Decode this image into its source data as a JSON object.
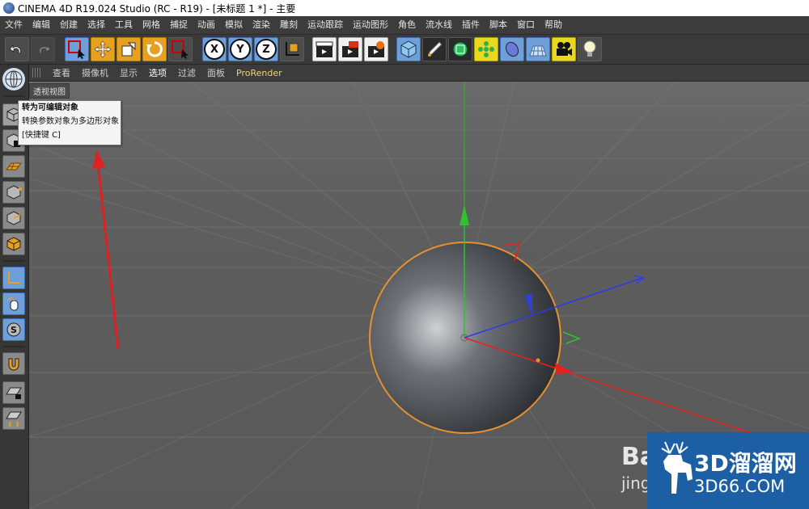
{
  "app": {
    "title": "CINEMA 4D R19.024 Studio (RC - R19) - [未标题 1 *] - 主要"
  },
  "menubar": {
    "items": [
      "文件",
      "编辑",
      "创建",
      "选择",
      "工具",
      "网格",
      "捕捉",
      "动画",
      "模拟",
      "渲染",
      "雕刻",
      "运动跟踪",
      "运动图形",
      "角色",
      "流水线",
      "插件",
      "脚本",
      "窗口",
      "帮助"
    ]
  },
  "toolbar": {
    "axis_x": "X",
    "axis_y": "Y",
    "axis_z": "Z"
  },
  "viewport_menu": {
    "items": [
      "查看",
      "摄像机",
      "显示",
      "选项",
      "过滤",
      "面板",
      "ProRender"
    ]
  },
  "viewport": {
    "label": "透视视图"
  },
  "tooltip": {
    "title": "转为可编辑对象",
    "description": "转换参数对象为多边形对象",
    "shortcut": "[快捷键 C]"
  },
  "watermark": {
    "baidu": "Bai",
    "jingyan": "jing",
    "site_name": "3D溜溜网",
    "site_url": "3D66.COM"
  },
  "colors": {
    "viewport_bg": "#5e5e5e",
    "accent_orange": "#e8a020",
    "axis_x": "#e02020",
    "axis_y": "#20c020",
    "axis_z": "#2040e0"
  }
}
